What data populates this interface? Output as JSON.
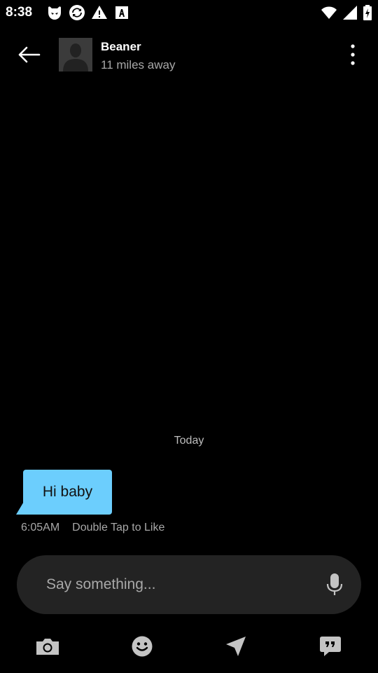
{
  "status_bar": {
    "time": "8:38",
    "left_icons": [
      "grindr-mask-icon",
      "sync-icon",
      "warning-icon",
      "a-box-icon"
    ],
    "right_icons": [
      "wifi-icon",
      "signal-icon",
      "battery-charging-icon"
    ]
  },
  "header": {
    "name": "Beaner",
    "distance": "11 miles away",
    "back_icon": "arrow-left-icon",
    "menu_icon": "more-vertical-icon"
  },
  "chat": {
    "date_separator": "Today",
    "messages": [
      {
        "text": "Hi baby",
        "time": "6:05AM",
        "like_hint": "Double Tap to Like"
      }
    ]
  },
  "composer": {
    "placeholder": "Say something...",
    "mic_icon": "microphone-icon"
  },
  "toolbar": {
    "items": [
      "camera-icon",
      "emoji-icon",
      "send-location-icon",
      "saved-phrases-icon"
    ]
  },
  "colors": {
    "background": "#000000",
    "bubble": "#6ccefd",
    "input_bg": "#232323",
    "secondary_text": "#a8a8a8",
    "icon_gray": "#c4c4c4"
  }
}
